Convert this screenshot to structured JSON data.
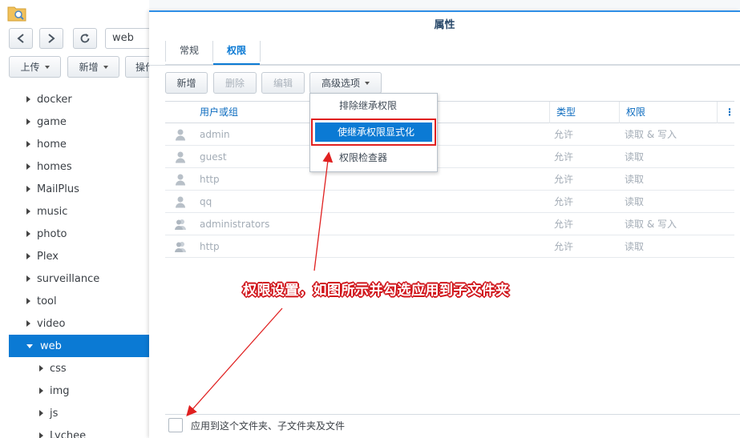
{
  "left_panel": {
    "path_value": "web",
    "toolbar": {
      "upload_label": "上传",
      "new_label": "新增",
      "action_label": "操作"
    },
    "tree": [
      {
        "label": "docker"
      },
      {
        "label": "game"
      },
      {
        "label": "home"
      },
      {
        "label": "homes"
      },
      {
        "label": "MailPlus"
      },
      {
        "label": "music"
      },
      {
        "label": "photo"
      },
      {
        "label": "Plex"
      },
      {
        "label": "surveillance"
      },
      {
        "label": "tool"
      },
      {
        "label": "video"
      },
      {
        "label": "web",
        "selected": true
      },
      {
        "label": "css",
        "child": true
      },
      {
        "label": "img",
        "child": true
      },
      {
        "label": "js",
        "child": true
      },
      {
        "label": "Lychee",
        "child": true
      }
    ]
  },
  "dialog": {
    "title": "属性",
    "tabs": [
      {
        "label": "常规"
      },
      {
        "label": "权限",
        "active": true
      }
    ],
    "buttons": {
      "add": "新增",
      "delete": "删除",
      "edit": "编辑",
      "advanced": "高级选项"
    },
    "columns": {
      "user": "用户或组",
      "type": "类型",
      "permission": "权限"
    },
    "rows": [
      {
        "name": "admin",
        "type": "允许",
        "permission": "读取 & 写入",
        "icon": "user-icon"
      },
      {
        "name": "guest",
        "type": "允许",
        "permission": "读取",
        "icon": "user-icon"
      },
      {
        "name": "http",
        "type": "允许",
        "permission": "读取",
        "icon": "user-icon"
      },
      {
        "name": "qq",
        "type": "允许",
        "permission": "读取",
        "icon": "user-icon"
      },
      {
        "name": "administrators",
        "type": "允许",
        "permission": "读取 & 写入",
        "icon": "group-icon"
      },
      {
        "name": "http",
        "type": "允许",
        "permission": "读取",
        "icon": "group-icon"
      }
    ],
    "menu": {
      "exclude_inherit": "排除继承权限",
      "make_inherit_explicit": "使继承权限显式化",
      "permission_inspector": "权限检查器"
    },
    "apply_checkbox_label": "应用到这个文件夹、子文件夹及文件",
    "apply_checked": false
  },
  "annotation": {
    "text": "权限设置，如图所示并勾选应用到子文件夹",
    "color": "#d0151b"
  },
  "colors": {
    "accent": "#0b7ad4",
    "highlight_border": "#e02020"
  }
}
